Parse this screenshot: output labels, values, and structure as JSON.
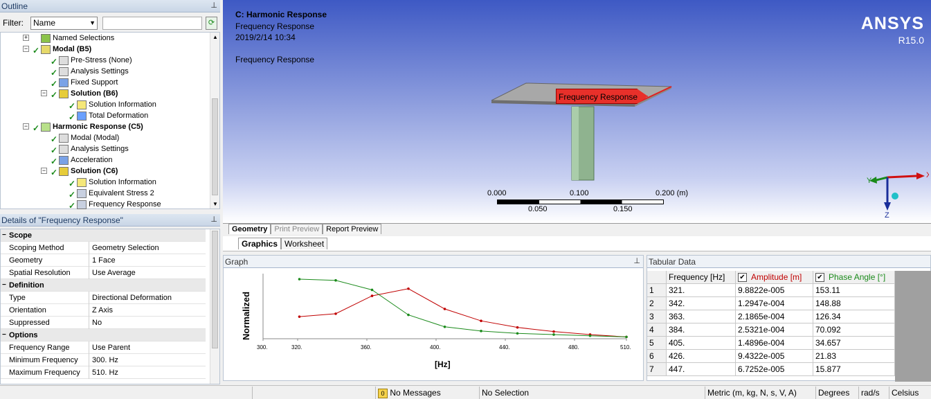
{
  "outline": {
    "title": "Outline",
    "filter_label": "Filter:",
    "filter_value": "Name",
    "tree": [
      {
        "label": "Named Selections",
        "bold": false,
        "icon": "named-selections-icon"
      },
      {
        "label": "Modal (B5)",
        "bold": true,
        "icon": "modal-analysis-icon"
      },
      {
        "label": "Pre-Stress (None)",
        "bold": false,
        "icon": "prestress-icon"
      },
      {
        "label": "Analysis Settings",
        "bold": false,
        "icon": "analysis-settings-icon"
      },
      {
        "label": "Fixed Support",
        "bold": false,
        "icon": "fixed-support-icon"
      },
      {
        "label": "Solution (B6)",
        "bold": true,
        "icon": "solution-icon"
      },
      {
        "label": "Solution Information",
        "bold": false,
        "icon": "solution-information-icon"
      },
      {
        "label": "Total Deformation",
        "bold": false,
        "icon": "total-deformation-icon"
      },
      {
        "label": "Harmonic Response (C5)",
        "bold": true,
        "icon": "harmonic-response-icon"
      },
      {
        "label": "Modal (Modal)",
        "bold": false,
        "icon": "modal-link-icon"
      },
      {
        "label": "Analysis Settings",
        "bold": false,
        "icon": "analysis-settings-icon"
      },
      {
        "label": "Acceleration",
        "bold": false,
        "icon": "acceleration-icon"
      },
      {
        "label": "Solution (C6)",
        "bold": true,
        "icon": "solution-icon"
      },
      {
        "label": "Solution Information",
        "bold": false,
        "icon": "solution-information-icon"
      },
      {
        "label": "Equivalent Stress 2",
        "bold": false,
        "icon": "equivalent-stress-icon"
      },
      {
        "label": "Frequency Response",
        "bold": false,
        "icon": "frequency-response-icon"
      }
    ]
  },
  "details": {
    "title": "Details of \"Frequency Response\"",
    "rows": [
      {
        "k": "Scope",
        "v": "",
        "section": true
      },
      {
        "k": "Scoping Method",
        "v": "Geometry Selection"
      },
      {
        "k": "Geometry",
        "v": "1 Face"
      },
      {
        "k": "Spatial Resolution",
        "v": "Use Average"
      },
      {
        "k": "Definition",
        "v": "",
        "section": true
      },
      {
        "k": "Type",
        "v": "Directional Deformation"
      },
      {
        "k": "Orientation",
        "v": "Z Axis"
      },
      {
        "k": "Suppressed",
        "v": "No"
      },
      {
        "k": "Options",
        "v": "",
        "section": true
      },
      {
        "k": "Frequency Range",
        "v": "Use Parent"
      },
      {
        "k": "Minimum Frequency",
        "v": "300. Hz"
      },
      {
        "k": "Maximum Frequency",
        "v": "510. Hz"
      }
    ]
  },
  "viewport": {
    "title": "C: Harmonic Response",
    "subtitle": "Frequency Response",
    "datetime": "2019/2/14 10:34",
    "label": "Frequency Response",
    "probe_label": "Frequency Response",
    "brand": "ANSYS",
    "version": "R15.0",
    "scale_top": [
      "0.000",
      "0.100",
      "0.200 (m)"
    ],
    "scale_bottom": [
      "0.050",
      "0.150"
    ],
    "axis_x": "X",
    "axis_y": "Y",
    "axis_z": "Z"
  },
  "view_tabs": [
    "Geometry",
    "Print Preview",
    "Report Preview"
  ],
  "sub_tabs": [
    "Graphics",
    "Worksheet"
  ],
  "graph": {
    "title": "Graph"
  },
  "tabular": {
    "title": "Tabular Data",
    "headers": [
      "Frequency [Hz]",
      "Amplitude [m]",
      "Phase Angle [°]"
    ],
    "rows": [
      [
        "1",
        "321.",
        "9.8822e-005",
        "153.11"
      ],
      [
        "2",
        "342.",
        "1.2947e-004",
        "148.88"
      ],
      [
        "3",
        "363.",
        "2.1865e-004",
        "126.34"
      ],
      [
        "4",
        "384.",
        "2.5321e-004",
        "70.092"
      ],
      [
        "5",
        "405.",
        "1.4896e-004",
        "34.657"
      ],
      [
        "6",
        "426.",
        "9.4322e-005",
        "21.83"
      ],
      [
        "7",
        "447.",
        "6.7252e-005",
        "15.877"
      ]
    ]
  },
  "chart_data": {
    "type": "line",
    "xlabel": "[Hz]",
    "ylabel": "Normalized",
    "xlim": [
      300,
      510
    ],
    "x_ticks": [
      "300.",
      "320.",
      "360.",
      "400.",
      "440.",
      "480.",
      "510."
    ],
    "x": [
      321,
      342,
      363,
      384,
      405,
      426,
      447,
      468,
      489,
      510
    ],
    "series": [
      {
        "name": "Amplitude [m]",
        "color": "#c00000",
        "values": [
          0.37,
          0.42,
          0.72,
          0.84,
          0.5,
          0.3,
          0.19,
          0.12,
          0.07,
          0.03
        ]
      },
      {
        "name": "Phase Angle [°]",
        "color": "#1a8a1a",
        "values": [
          1.0,
          0.98,
          0.82,
          0.4,
          0.2,
          0.13,
          0.09,
          0.07,
          0.05,
          0.03
        ]
      }
    ]
  },
  "status": {
    "messages": "No Messages",
    "selection": "No Selection",
    "units": "Metric (m, kg, N, s, V, A)",
    "angle": "Degrees",
    "rate": "rad/s",
    "temp": "Celsius"
  },
  "colors": {
    "amplitude": "#c00000",
    "phase": "#1a8a1a",
    "panel_header": "#c9d6e6",
    "probe": "#e8302a"
  }
}
